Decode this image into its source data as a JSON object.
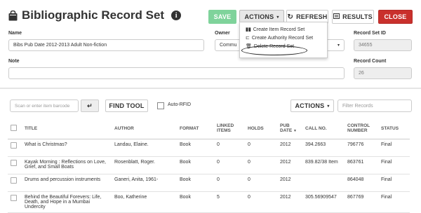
{
  "header": {
    "title": "Bibliographic Record Set",
    "info": "i",
    "save": "SAVE",
    "actions": "ACTIONS",
    "refresh": "REFRESH",
    "results": "RESULTS",
    "close": "CLOSE"
  },
  "form": {
    "name_label": "Name",
    "name_value": "Bibs Pub Date 2012-2013 Adult Non-fiction",
    "owner_label": "Owner",
    "owner_value": "Commu",
    "record_set_id_label": "Record Set ID",
    "record_set_id_value": "34655",
    "note_label": "Note",
    "note_value": "",
    "record_count_label": "Record Count",
    "record_count_value": "26"
  },
  "actions_menu": {
    "items": [
      {
        "label": "Create Item Record Set",
        "icon": "books-icon"
      },
      {
        "label": "Create Authority Record Set",
        "icon": "hierarchy-icon"
      },
      {
        "label": "Delete Record Set",
        "icon": "trash-icon"
      }
    ]
  },
  "toolbar": {
    "scan_placeholder": "Scan or enter item barcode",
    "find_tool": "FIND TOOL",
    "auto_rfid": "Auto-RFID",
    "actions": "ACTIONS",
    "filter_placeholder": "Filter Records"
  },
  "table": {
    "headers": [
      "TITLE",
      "AUTHOR",
      "FORMAT",
      "LINKED ITEMS",
      "HOLDS",
      "PUB DATE",
      "CALL NO.",
      "CONTROL NUMBER",
      "STATUS"
    ],
    "sort_indicator": "▼",
    "rows": [
      {
        "title": "What is Christmas?",
        "author": "Landau, Elaine.",
        "format": "Book",
        "linked": "0",
        "holds": "0",
        "pub": "2012",
        "call": "394.2663",
        "control": "796776",
        "status": "Final"
      },
      {
        "title": "Kayak Morning : Reflections on Love, Grief, and Small Boats",
        "author": "Rosenblatt, Roger.",
        "format": "Book",
        "linked": "0",
        "holds": "0",
        "pub": "2012",
        "call": "839.82/38 Item",
        "control": "863761",
        "status": "Final"
      },
      {
        "title": "Drums and percussion instruments",
        "author": "Ganeri, Anita, 1961-",
        "format": "Book",
        "linked": "0",
        "holds": "0",
        "pub": "2012",
        "call": "",
        "control": "864048",
        "status": "Final"
      },
      {
        "title": "Behind the Beautiful Forevers: Life, Death, and Hope in a Mumbai Undercity",
        "author": "Boo, Katherine",
        "format": "Book",
        "linked": "5",
        "holds": "0",
        "pub": "2012",
        "call": "305.56909547",
        "control": "867769",
        "status": "Final"
      }
    ]
  }
}
